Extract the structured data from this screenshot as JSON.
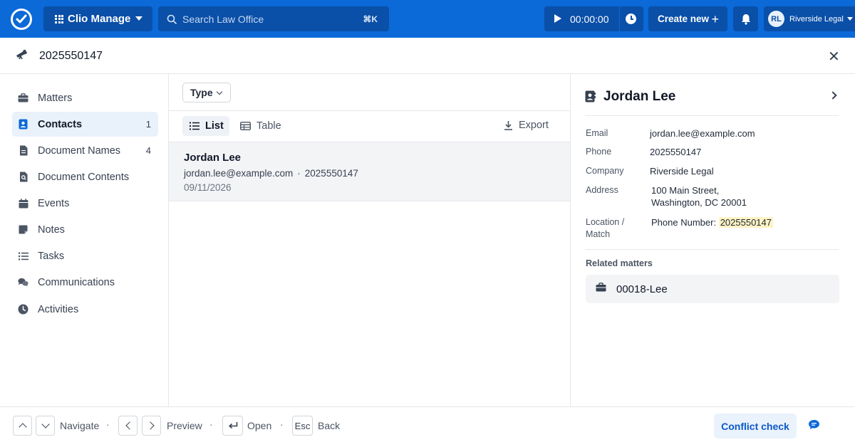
{
  "topbar": {
    "app_name": "Clio Manage",
    "search_placeholder": "Search Law Office",
    "search_shortcut": "⌘K",
    "timer": "00:00:00",
    "create_new": "Create new",
    "user_initials": "RL",
    "user_name": "Riverside Legal",
    "accent_color": "#0b69d8"
  },
  "subheader": {
    "query": "2025550147"
  },
  "nav": {
    "items": [
      {
        "label": "Matters",
        "icon": "briefcase-icon",
        "count": ""
      },
      {
        "label": "Contacts",
        "icon": "contact-card-icon",
        "count": "1"
      },
      {
        "label": "Document Names",
        "icon": "document-icon",
        "count": "4"
      },
      {
        "label": "Document Contents",
        "icon": "document-search-icon",
        "count": ""
      },
      {
        "label": "Events",
        "icon": "calendar-icon",
        "count": ""
      },
      {
        "label": "Notes",
        "icon": "note-icon",
        "count": ""
      },
      {
        "label": "Tasks",
        "icon": "task-list-icon",
        "count": ""
      },
      {
        "label": "Communications",
        "icon": "chat-bubbles-icon",
        "count": ""
      },
      {
        "label": "Activities",
        "icon": "clock-icon",
        "count": ""
      }
    ],
    "active_index": 1
  },
  "results": {
    "type_filter": "Type",
    "view_list": "List",
    "view_table": "Table",
    "export": "Export",
    "items": [
      {
        "name": "Jordan Lee",
        "email": "jordan.lee@example.com",
        "separator": "·",
        "phone": "2025550147",
        "date": "09/11/2026"
      }
    ]
  },
  "detail": {
    "name": "Jordan Lee",
    "fields": {
      "email_label": "Email",
      "email_value": "jordan.lee@example.com",
      "phone_label": "Phone",
      "phone_value": "2025550147",
      "company_label": "Company",
      "company_value": "Riverside Legal",
      "address_label": "Address",
      "address_line1": "100 Main Street,",
      "address_line2": "Washington, DC 20001",
      "match_label_line1": "Location /",
      "match_label_line2": "Match",
      "match_prefix": "Phone Number:",
      "match_value": "2025550147"
    },
    "related_title": "Related matters",
    "related_matters": [
      {
        "label": "00018-Lee"
      }
    ]
  },
  "footer": {
    "navigate": "Navigate",
    "preview": "Preview",
    "open": "Open",
    "esc_key": "Esc",
    "back": "Back",
    "dot": "·",
    "conflict_check": "Conflict check"
  }
}
